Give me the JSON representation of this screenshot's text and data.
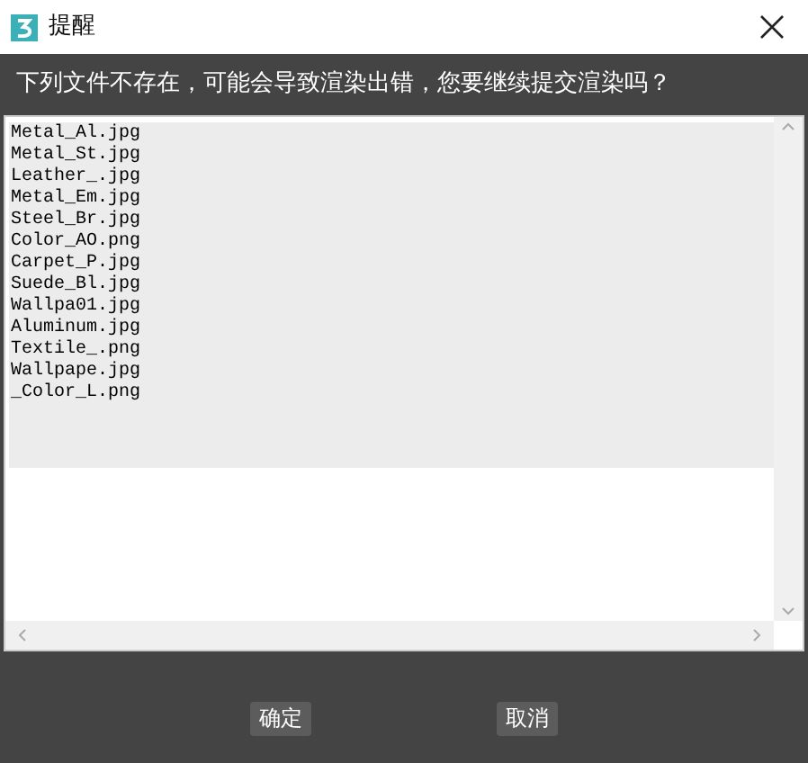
{
  "window": {
    "title": "提醒"
  },
  "message": "下列文件不存在，可能会导致渲染出错，您要继续提交渲染吗？",
  "files": [
    "Metal_Al.jpg",
    "Metal_St.jpg",
    "Leather_.jpg",
    "Metal_Em.jpg",
    "Steel_Br.jpg",
    "Color_AO.png",
    "Carpet_P.jpg",
    "Suede_Bl.jpg",
    "Wallpa01.jpg",
    "Aluminum.jpg",
    "Textile_.png",
    "Wallpape.jpg",
    "_Color_L.png"
  ],
  "buttons": [
    "确定",
    "取消"
  ]
}
